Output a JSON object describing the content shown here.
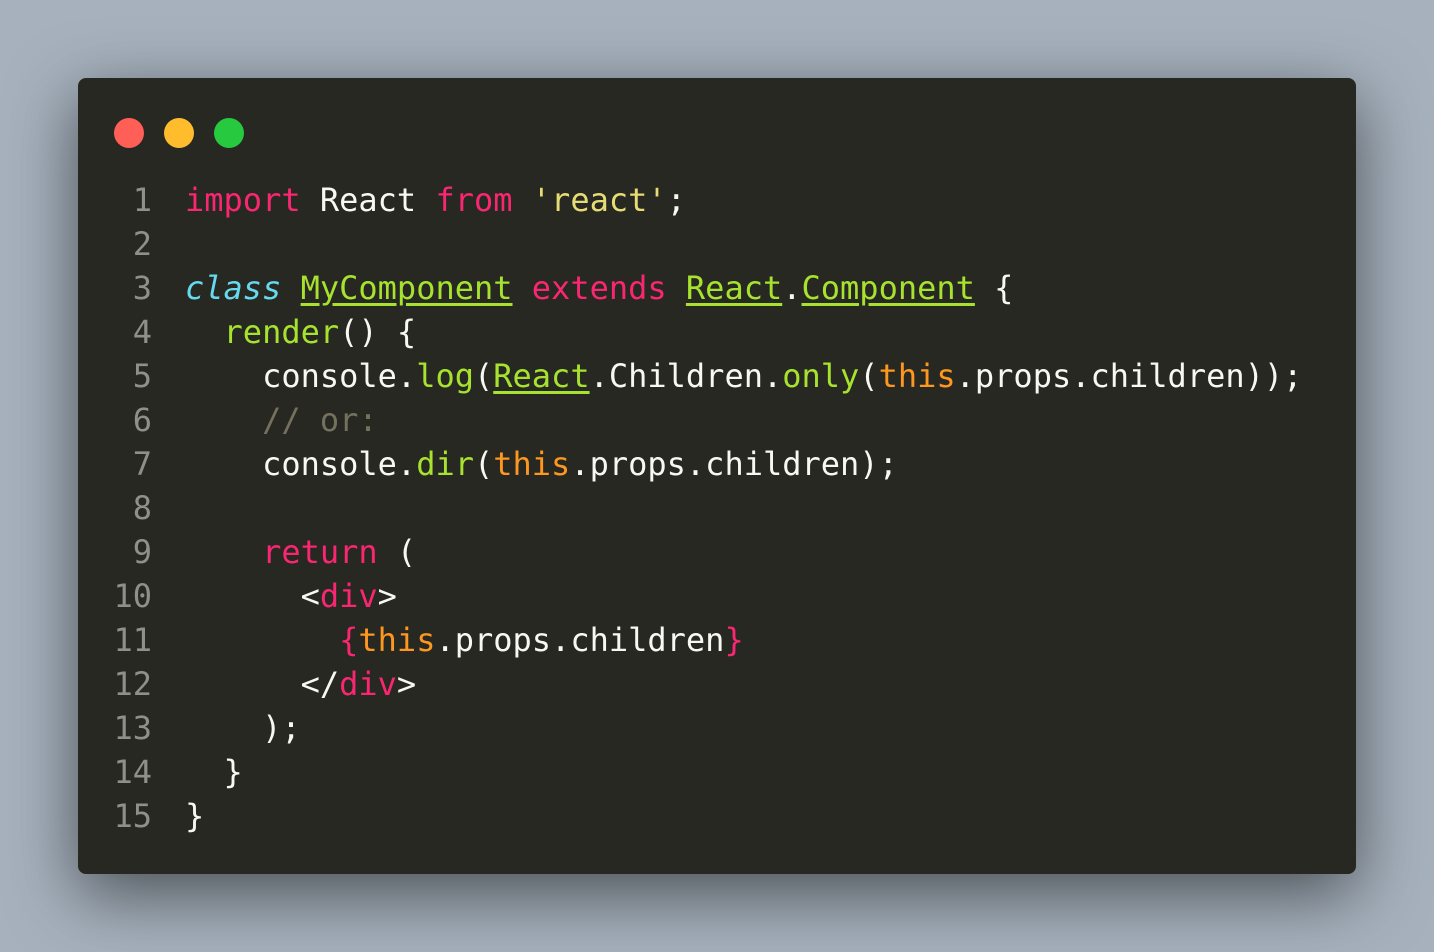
{
  "window": {
    "controls": [
      {
        "name": "close",
        "color": "#ff5f56"
      },
      {
        "name": "minimize",
        "color": "#ffbd2e"
      },
      {
        "name": "maximize",
        "color": "#27c93f"
      }
    ]
  },
  "code": {
    "lines": [
      {
        "n": "1",
        "tokens": [
          {
            "t": "import",
            "c": "kw"
          },
          {
            "t": " React ",
            "c": "plain"
          },
          {
            "t": "from",
            "c": "kw"
          },
          {
            "t": " ",
            "c": "plain"
          },
          {
            "t": "'react'",
            "c": "str"
          },
          {
            "t": ";",
            "c": "plain"
          }
        ]
      },
      {
        "n": "2",
        "tokens": []
      },
      {
        "n": "3",
        "tokens": [
          {
            "t": "class",
            "c": "stor"
          },
          {
            "t": " ",
            "c": "plain"
          },
          {
            "t": "MyComponent",
            "c": "cls"
          },
          {
            "t": " ",
            "c": "plain"
          },
          {
            "t": "extends",
            "c": "kw"
          },
          {
            "t": " ",
            "c": "plain"
          },
          {
            "t": "React",
            "c": "cls"
          },
          {
            "t": ".",
            "c": "plain"
          },
          {
            "t": "Component",
            "c": "cls"
          },
          {
            "t": " {",
            "c": "plain"
          }
        ]
      },
      {
        "n": "4",
        "tokens": [
          {
            "t": "  ",
            "c": "plain"
          },
          {
            "t": "render",
            "c": "fn"
          },
          {
            "t": "() {",
            "c": "plain"
          }
        ]
      },
      {
        "n": "5",
        "tokens": [
          {
            "t": "    console.",
            "c": "plain"
          },
          {
            "t": "log",
            "c": "fn"
          },
          {
            "t": "(",
            "c": "plain"
          },
          {
            "t": "React",
            "c": "cls"
          },
          {
            "t": ".Children.",
            "c": "plain"
          },
          {
            "t": "only",
            "c": "fn"
          },
          {
            "t": "(",
            "c": "plain"
          },
          {
            "t": "this",
            "c": "this"
          },
          {
            "t": ".props.children));",
            "c": "plain"
          }
        ]
      },
      {
        "n": "6",
        "tokens": [
          {
            "t": "    ",
            "c": "plain"
          },
          {
            "t": "// or:",
            "c": "cmt"
          }
        ]
      },
      {
        "n": "7",
        "tokens": [
          {
            "t": "    console.",
            "c": "plain"
          },
          {
            "t": "dir",
            "c": "fn"
          },
          {
            "t": "(",
            "c": "plain"
          },
          {
            "t": "this",
            "c": "this"
          },
          {
            "t": ".props.children);",
            "c": "plain"
          }
        ]
      },
      {
        "n": "8",
        "tokens": []
      },
      {
        "n": "9",
        "tokens": [
          {
            "t": "    ",
            "c": "plain"
          },
          {
            "t": "return",
            "c": "kw"
          },
          {
            "t": " (",
            "c": "plain"
          }
        ]
      },
      {
        "n": "10",
        "tokens": [
          {
            "t": "      <",
            "c": "plain"
          },
          {
            "t": "div",
            "c": "tag"
          },
          {
            "t": ">",
            "c": "plain"
          }
        ]
      },
      {
        "n": "11",
        "tokens": [
          {
            "t": "        ",
            "c": "plain"
          },
          {
            "t": "{",
            "c": "kw"
          },
          {
            "t": "this",
            "c": "this"
          },
          {
            "t": ".props.children",
            "c": "plain"
          },
          {
            "t": "}",
            "c": "kw"
          }
        ]
      },
      {
        "n": "12",
        "tokens": [
          {
            "t": "      </",
            "c": "plain"
          },
          {
            "t": "div",
            "c": "tag"
          },
          {
            "t": ">",
            "c": "plain"
          }
        ]
      },
      {
        "n": "13",
        "tokens": [
          {
            "t": "    );",
            "c": "plain"
          }
        ]
      },
      {
        "n": "14",
        "tokens": [
          {
            "t": "  }",
            "c": "plain"
          }
        ]
      },
      {
        "n": "15",
        "tokens": [
          {
            "t": "}",
            "c": "plain"
          }
        ]
      }
    ]
  }
}
